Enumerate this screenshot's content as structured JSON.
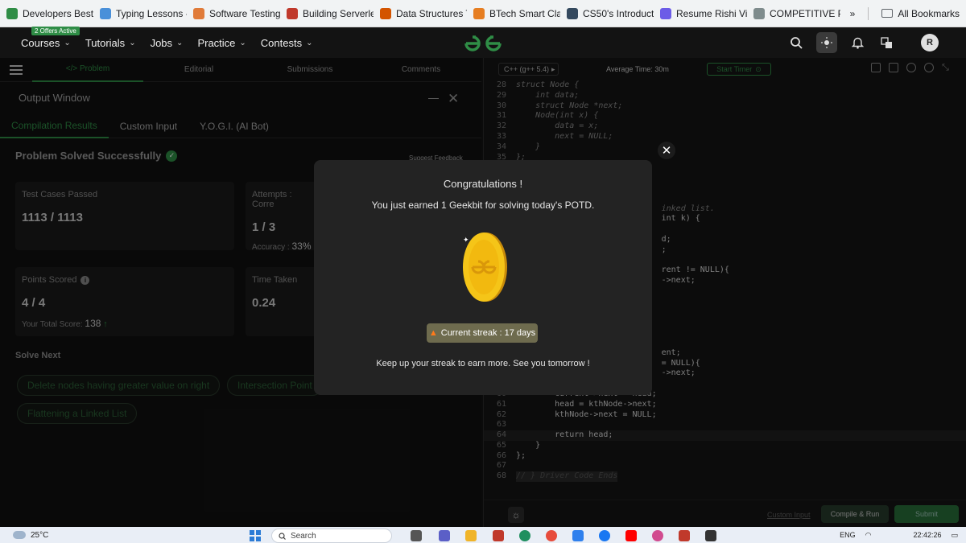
{
  "bookmarks": {
    "items": [
      {
        "label": "Developers Best Pra...",
        "color": "#2f8d46"
      },
      {
        "label": "Typing Lessons - Le...",
        "color": "#4a90d9"
      },
      {
        "label": "Software Testing | S...",
        "color": "#e07b39"
      },
      {
        "label": "Building Serverless...",
        "color": "#c0392b"
      },
      {
        "label": "Data Structures Tut...",
        "color": "#d35400"
      },
      {
        "label": "BTech Smart Class",
        "color": "#e67e22"
      },
      {
        "label": "CS50's Introduction...",
        "color": "#34495e"
      },
      {
        "label": "Resume Rishi Vijay...",
        "color": "#6c5ce7"
      },
      {
        "label": "COMPETITIVE PROG...",
        "color": "#7f8c8d"
      }
    ],
    "more_label": "»",
    "all_bookmarks_label": "All Bookmarks"
  },
  "header": {
    "offers_badge": "2 Offers Active",
    "nav": [
      {
        "label": "Courses"
      },
      {
        "label": "Tutorials"
      },
      {
        "label": "Jobs"
      },
      {
        "label": "Practice"
      },
      {
        "label": "Contests"
      }
    ],
    "avatar_initial": "R",
    "icons": [
      "search-icon",
      "theme-sun-icon",
      "bell-icon",
      "translate-icon"
    ]
  },
  "problem_tabs": [
    {
      "label": "</> Problem",
      "active": true
    },
    {
      "label": "Editorial",
      "active": false
    },
    {
      "label": "Submissions",
      "active": false
    },
    {
      "label": "Comments",
      "active": false
    }
  ],
  "output": {
    "title": "Output Window",
    "tabs": [
      {
        "label": "Compilation Results",
        "active": true
      },
      {
        "label": "Custom Input",
        "active": false
      },
      {
        "label": "Y.O.G.I. (AI Bot)",
        "active": false
      }
    ],
    "status": "Problem Solved Successfully",
    "suggest_feedback": "Suggest Feedback",
    "cards": {
      "test_cases": {
        "label": "Test Cases Passed",
        "value": "1113 / 1113"
      },
      "attempts": {
        "label": "Attempts : Corre",
        "value": "1 / 3",
        "accuracy_label": "Accuracy :",
        "accuracy_value": "33%"
      },
      "points": {
        "label": "Points Scored",
        "value": "4 / 4",
        "total_label": "Your Total Score:",
        "total_value": "138"
      },
      "time": {
        "label": "Time Taken",
        "value": "0.24"
      }
    },
    "solve_next_title": "Solve Next",
    "solve_next": [
      "Delete nodes having greater value on right",
      "Intersection Point",
      "Flattening a Linked List"
    ]
  },
  "editor": {
    "language": "C++ (g++ 5.4)",
    "avg_time": "Average Time: 30m",
    "start_timer": "Start Timer",
    "lines": [
      {
        "n": "28",
        "text": "struct Node {",
        "style": "it"
      },
      {
        "n": "29",
        "text": "    int data;",
        "style": "it"
      },
      {
        "n": "30",
        "text": "    struct Node *next;",
        "style": "it"
      },
      {
        "n": "31",
        "text": "    Node(int x) {",
        "style": "it"
      },
      {
        "n": "32",
        "text": "        data = x;",
        "style": "it"
      },
      {
        "n": "33",
        "text": "        next = NULL;",
        "style": "it"
      },
      {
        "n": "34",
        "text": "    }",
        "style": "it"
      },
      {
        "n": "35",
        "text": "};",
        "style": "it"
      },
      {
        "n": "",
        "text": "",
        "style": ""
      },
      {
        "n": "",
        "text": "",
        "style": ""
      },
      {
        "n": "",
        "text": "",
        "style": ""
      },
      {
        "n": "",
        "text": "",
        "style": ""
      },
      {
        "n": "",
        "text": "                              inked list.",
        "style": "it"
      },
      {
        "n": "",
        "text": "                              int k) {",
        "style": ""
      },
      {
        "n": "",
        "text": "",
        "style": ""
      },
      {
        "n": "",
        "text": "                              d;",
        "style": ""
      },
      {
        "n": "",
        "text": "                              ;",
        "style": ""
      },
      {
        "n": "",
        "text": "",
        "style": ""
      },
      {
        "n": "",
        "text": "                              rent != NULL){",
        "style": ""
      },
      {
        "n": "",
        "text": "                              ->next;",
        "style": ""
      },
      {
        "n": "",
        "text": "",
        "style": ""
      },
      {
        "n": "",
        "text": "",
        "style": ""
      },
      {
        "n": "",
        "text": "",
        "style": ""
      },
      {
        "n": "",
        "text": "",
        "style": ""
      },
      {
        "n": "",
        "text": "",
        "style": ""
      },
      {
        "n": "",
        "text": "",
        "style": ""
      },
      {
        "n": "",
        "text": "                              ent;",
        "style": ""
      },
      {
        "n": "",
        "text": "                              = NULL){",
        "style": ""
      },
      {
        "n": "",
        "text": "                              ->next;",
        "style": ""
      },
      {
        "n": "59",
        "text": "        }",
        "style": ""
      },
      {
        "n": "60",
        "text": "        current->next = head;",
        "style": ""
      },
      {
        "n": "61",
        "text": "        head = kthNode->next;",
        "style": ""
      },
      {
        "n": "62",
        "text": "        kthNode->next = NULL;",
        "style": ""
      },
      {
        "n": "63",
        "text": "",
        "style": ""
      },
      {
        "n": "64",
        "text": "        return head;",
        "style": "hl"
      },
      {
        "n": "65",
        "text": "    }",
        "style": ""
      },
      {
        "n": "66",
        "text": "};",
        "style": ""
      },
      {
        "n": "67",
        "text": "",
        "style": ""
      },
      {
        "n": "68",
        "text": "// } Driver Code Ends",
        "style": "cmt"
      }
    ],
    "custom_input": "Custom Input",
    "compile_run": "Compile & Run",
    "submit": "Submit"
  },
  "modal": {
    "title": "Congratulations !",
    "message": "You just earned 1 Geekbit for solving today's POTD.",
    "streak": "Current streak : 17 days",
    "footer": "Keep up your streak to earn more. See you tomorrow !"
  },
  "taskbar": {
    "temp": "25°C",
    "search_placeholder": "Search",
    "lang": "ENG",
    "time": "22:42:26"
  },
  "colors": {
    "accent": "#2f8d46",
    "coin": "#f5c518",
    "streak_bg": "#6e6b4e"
  }
}
